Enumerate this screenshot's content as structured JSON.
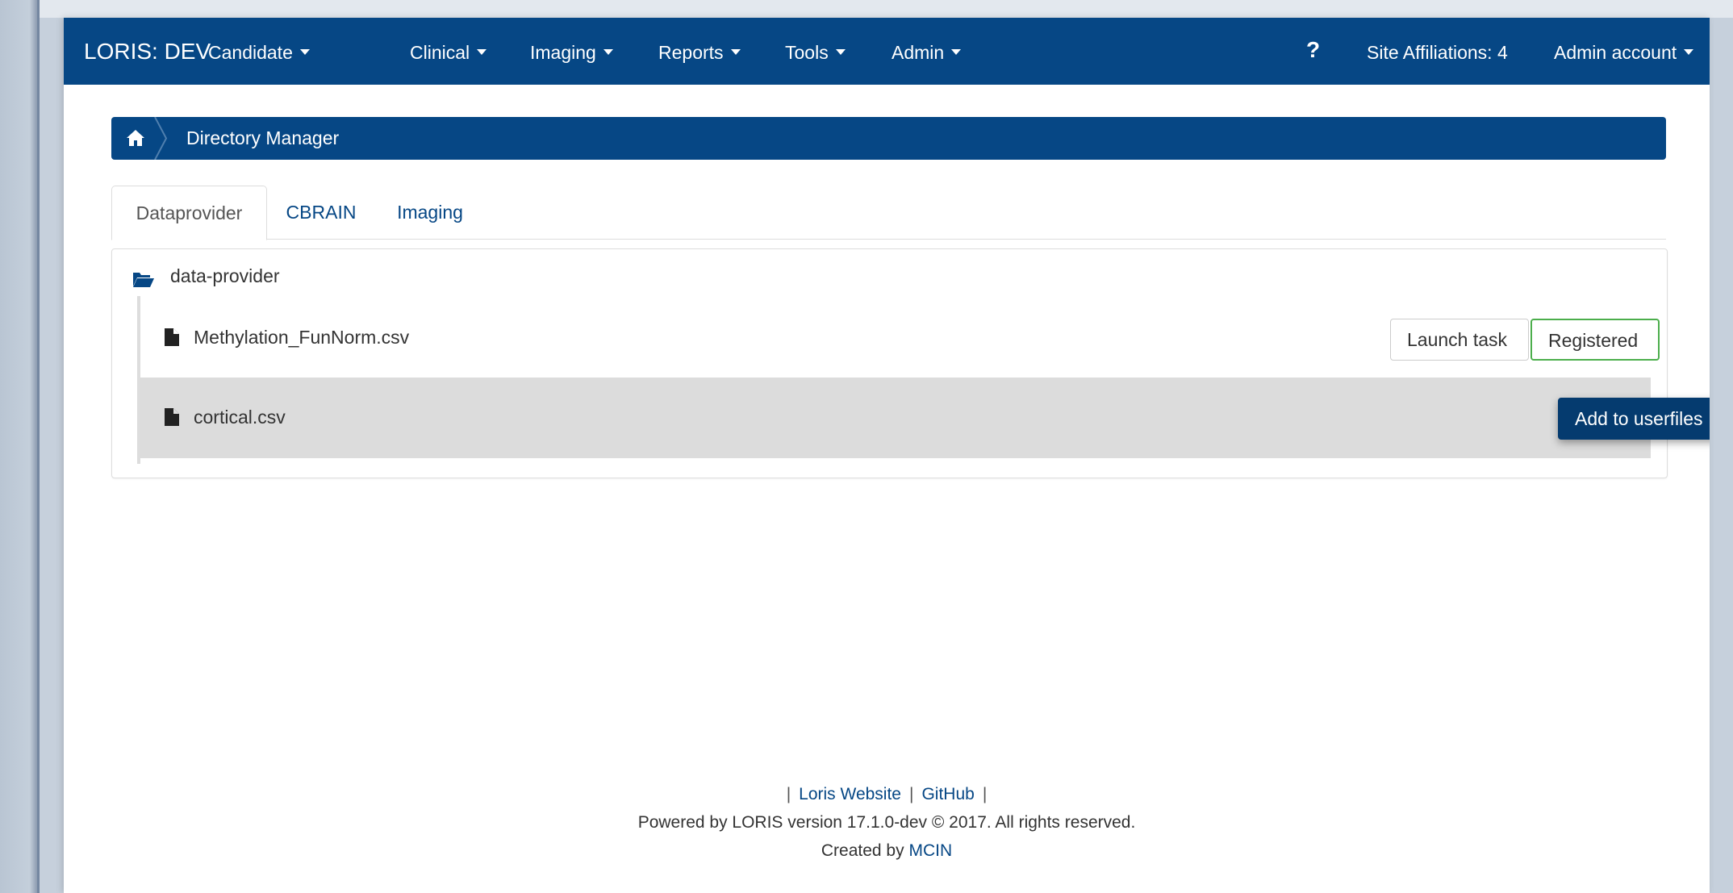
{
  "navbar": {
    "brand": "LORIS: DEV",
    "menus": [
      {
        "label": "Candidate"
      },
      {
        "label": "Clinical"
      },
      {
        "label": "Imaging"
      },
      {
        "label": "Reports"
      },
      {
        "label": "Tools"
      },
      {
        "label": "Admin"
      }
    ],
    "help_label": "?",
    "site_affiliations": "Site Affiliations: 4",
    "account": "Admin account"
  },
  "breadcrumb": {
    "home_icon": "home-icon",
    "current": "Directory Manager"
  },
  "tabs": [
    {
      "label": "Dataprovider",
      "active": true
    },
    {
      "label": "CBRAIN",
      "active": false
    },
    {
      "label": "Imaging",
      "active": false
    }
  ],
  "tree": {
    "folder_icon": "folder-open-icon",
    "folder": "data-provider",
    "files": [
      {
        "name": "Methylation_FunNorm.csv",
        "icon": "file-icon",
        "actions": [
          "Launch task",
          "Registered"
        ]
      },
      {
        "name": "cortical.csv",
        "icon": "file-icon",
        "highlighted": true,
        "actions": [
          "Add to userfiles"
        ]
      }
    ]
  },
  "footer": {
    "sep": "|",
    "link_website": "Loris Website",
    "link_github": "GitHub",
    "powered": "Powered by LORIS version 17.1.0-dev © 2017. All rights reserved.",
    "created_prefix": "Created by",
    "created_link": "MCIN"
  },
  "colors": {
    "navbar": "#064785",
    "link": "#064785",
    "registered_border": "#4cae4c",
    "add_button": "#053b6f",
    "highlight_row": "#dcdcdc"
  }
}
